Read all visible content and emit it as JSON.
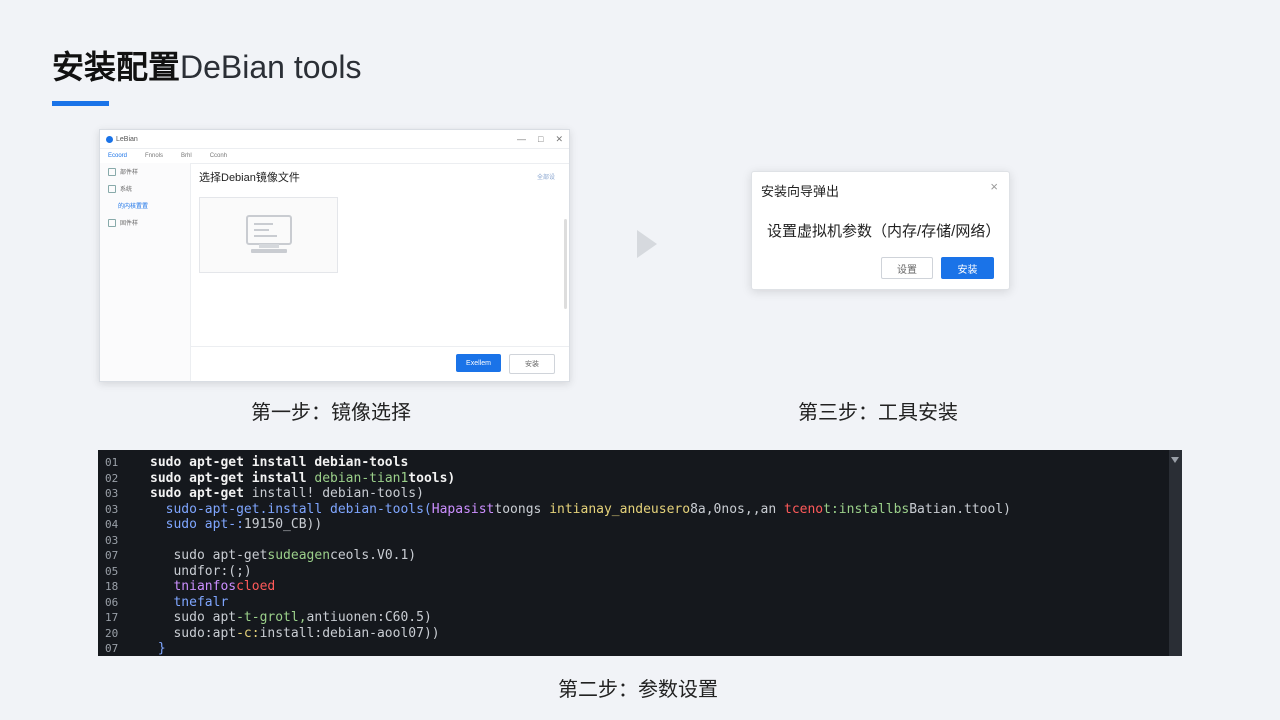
{
  "slide": {
    "title_bold": "安装配置",
    "title_rest": "DeBian tools"
  },
  "window": {
    "title": "LeBian",
    "menu": [
      "Ecoord",
      "Fnnols",
      "Brhl",
      "Cconh"
    ],
    "sidebar": [
      "部件样",
      "系统",
      "的内核置置",
      "固件样"
    ],
    "heading": "选择Debian镜像文件",
    "top_link": "全部设",
    "primary_button": "Exellem",
    "secondary_button": "安装"
  },
  "captions": {
    "step1": "第一步：镜像选择",
    "step2": "第二步：参数设置",
    "step3": "第三步：工具安装"
  },
  "dialog": {
    "title": "安装向导弹出",
    "close": "×",
    "body": "设置虚拟机参数（内存/存储/网络）",
    "cancel": "设置",
    "ok": "安装"
  },
  "terminal": {
    "lines": [
      {
        "n": "01",
        "parts": [
          {
            "t": "sudo apt-get install debian-tools",
            "c": "c-w"
          }
        ]
      },
      {
        "n": "02",
        "parts": [
          {
            "t": "sudo apt-get install ",
            "c": "c-w"
          },
          {
            "t": "debian-tian1",
            "c": "c-g"
          },
          {
            "t": "tools)",
            "c": "c-w"
          }
        ]
      },
      {
        "n": "03",
        "parts": [
          {
            "t": "sudo apt-get ",
            "c": "c-w"
          },
          {
            "t": "install! debian-tools)",
            "c": "c-d"
          }
        ]
      },
      {
        "n": "03",
        "parts": [
          {
            "t": "  sudo-apt-get.install debian-tools(",
            "c": "c-b"
          },
          {
            "t": "Hapasist",
            "c": "c-m"
          },
          {
            "t": "toongs ",
            "c": "c-d"
          },
          {
            "t": "intianay_andeusero",
            "c": "c-y"
          },
          {
            "t": "8a,0nos,,an ",
            "c": "c-d"
          },
          {
            "t": "tceno",
            "c": "c-r"
          },
          {
            "t": "t:installbs",
            "c": "c-g"
          },
          {
            "t": "Batian.ttool)",
            "c": "c-d"
          }
        ]
      },
      {
        "n": "04",
        "parts": [
          {
            "t": "  sudo apt-:",
            "c": "c-b"
          },
          {
            "t": "19150_CB))",
            "c": "c-d"
          }
        ]
      },
      {
        "n": "03",
        "parts": []
      },
      {
        "n": "07",
        "parts": [
          {
            "t": "   sudo apt-get",
            "c": "c-d"
          },
          {
            "t": "sudeagen",
            "c": "c-g"
          },
          {
            "t": "ceols.V0.1)",
            "c": "c-d"
          }
        ]
      },
      {
        "n": "05",
        "parts": [
          {
            "t": "   undfor:(;)",
            "c": "c-d"
          }
        ]
      },
      {
        "n": "18",
        "parts": [
          {
            "t": "   tnianfos",
            "c": "c-m"
          },
          {
            "t": "cloed",
            "c": "c-r"
          }
        ]
      },
      {
        "n": "06",
        "parts": [
          {
            "t": "   tnefalr",
            "c": "c-b"
          }
        ]
      },
      {
        "n": "17",
        "parts": [
          {
            "t": "   sudo apt",
            "c": "c-d"
          },
          {
            "t": "-t-grotl,",
            "c": "c-g"
          },
          {
            "t": "antiuonen:C60.5)",
            "c": "c-d"
          }
        ]
      },
      {
        "n": "20",
        "parts": [
          {
            "t": "   sudo:apt",
            "c": "c-d"
          },
          {
            "t": "-c:",
            "c": "c-y"
          },
          {
            "t": "install:debian-aool07))",
            "c": "c-d"
          }
        ]
      },
      {
        "n": "07",
        "parts": [
          {
            "t": " }",
            "c": "c-b"
          }
        ]
      }
    ]
  },
  "colors": {
    "accent": "#1a73e8",
    "background": "#f1f3f7",
    "terminal_bg": "#15181d"
  }
}
